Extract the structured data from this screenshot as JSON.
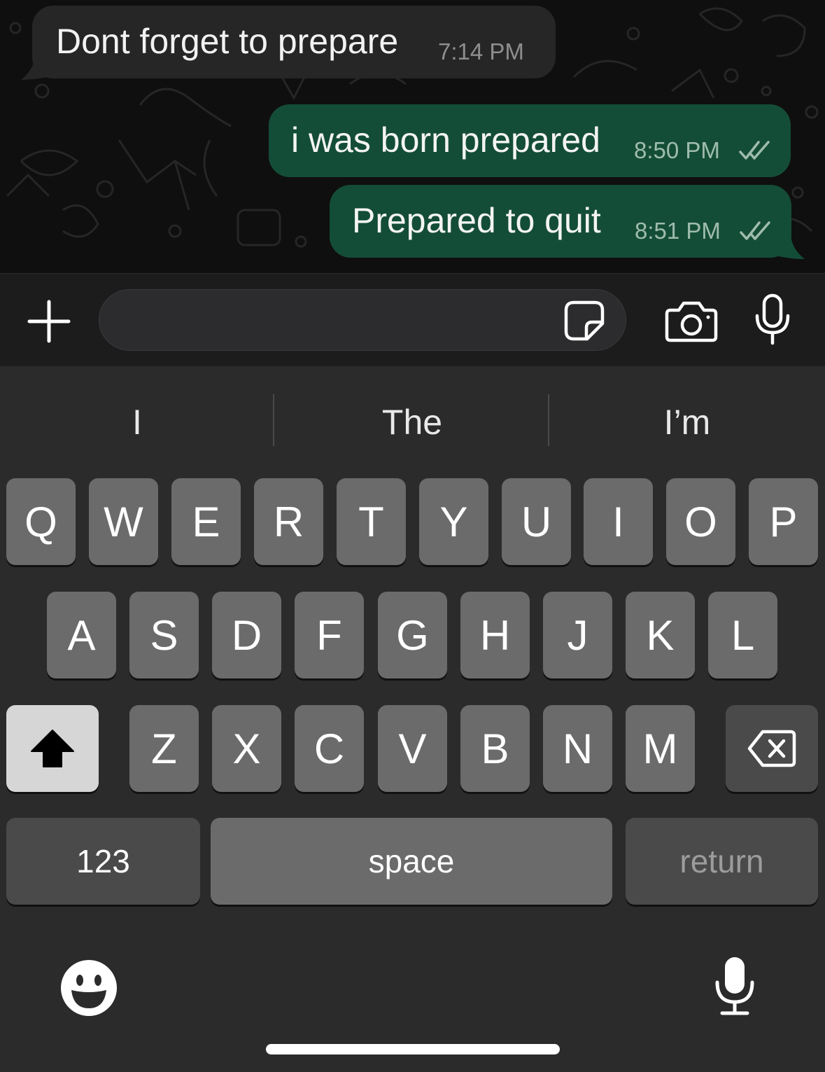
{
  "messages": [
    {
      "direction": "incoming",
      "text": "Dont forget to prepare",
      "time": "7:14 PM"
    },
    {
      "direction": "outgoing",
      "text": "i was born prepared",
      "time": "8:50 PM",
      "status": "read"
    },
    {
      "direction": "outgoing",
      "text": "Prepared to quit",
      "time": "8:51 PM",
      "status": "read"
    }
  ],
  "input_bar": {
    "message_value": "",
    "icons": [
      "plus-icon",
      "sticker-icon",
      "camera-icon",
      "microphone-icon"
    ]
  },
  "keyboard": {
    "suggestions": [
      "I",
      "The",
      "I’m"
    ],
    "row1": [
      "Q",
      "W",
      "E",
      "R",
      "T",
      "Y",
      "U",
      "I",
      "O",
      "P"
    ],
    "row2": [
      "A",
      "S",
      "D",
      "F",
      "G",
      "H",
      "J",
      "K",
      "L"
    ],
    "row3": [
      "Z",
      "X",
      "C",
      "V",
      "B",
      "N",
      "M"
    ],
    "numbers_label": "123",
    "space_label": "space",
    "return_label": "return",
    "icons": [
      "shift-icon",
      "backspace-icon",
      "emoji-icon",
      "dictation-icon"
    ]
  },
  "colors": {
    "chat_background": "#0f0f0f",
    "incoming_bubble": "#262627",
    "outgoing_bubble": "#144d37",
    "keyboard_background": "#2b2b2c",
    "key": "#6b6b6c"
  }
}
